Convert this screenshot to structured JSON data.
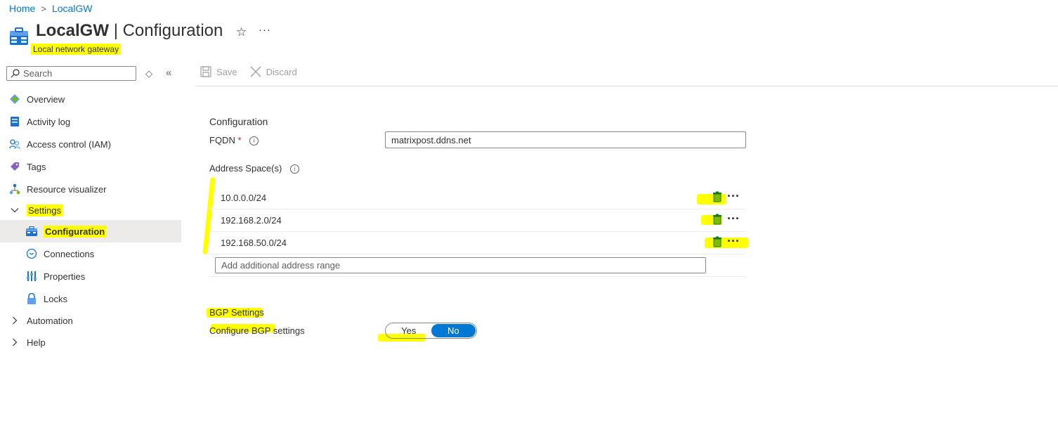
{
  "breadcrumb": {
    "home": "Home",
    "separator": ">",
    "current": "LocalGW"
  },
  "header": {
    "resource_name": "LocalGW",
    "divider": "|",
    "page_name": "Configuration",
    "subtitle": "Local network gateway",
    "favorite_icon": "star-icon",
    "more_icon": "ellipsis-icon"
  },
  "sidebar": {
    "search_placeholder": "Search",
    "items": [
      {
        "label": "Overview",
        "icon": "overview-icon"
      },
      {
        "label": "Activity log",
        "icon": "activity-log-icon"
      },
      {
        "label": "Access control (IAM)",
        "icon": "iam-icon"
      },
      {
        "label": "Tags",
        "icon": "tag-icon"
      },
      {
        "label": "Resource visualizer",
        "icon": "visualizer-icon"
      },
      {
        "label": "Settings",
        "icon": "chevron-down-icon",
        "expanded": true
      },
      {
        "label": "Configuration",
        "icon": "gateway-icon",
        "selected": true
      },
      {
        "label": "Connections",
        "icon": "connections-icon"
      },
      {
        "label": "Properties",
        "icon": "properties-icon"
      },
      {
        "label": "Locks",
        "icon": "lock-icon"
      },
      {
        "label": "Automation",
        "icon": "chevron-right-icon"
      },
      {
        "label": "Help",
        "icon": "chevron-right-icon"
      }
    ]
  },
  "toolbar": {
    "save": "Save",
    "discard": "Discard"
  },
  "form": {
    "section_title": "Configuration",
    "fqdn_label": "FQDN",
    "required_mark": "*",
    "fqdn_value": "matrixpost.ddns.net",
    "address_space_label": "Address Space(s)",
    "address_spaces": [
      "10.0.0.0/24",
      "192.168.2.0/24",
      "192.168.50.0/24"
    ],
    "add_placeholder": "Add additional address range"
  },
  "bgp": {
    "section_title": "BGP Settings",
    "configure_label": "Configure BGP settings",
    "yes": "Yes",
    "no": "No",
    "selected": "No"
  },
  "colors": {
    "accent": "#0078d4",
    "highlight": "#ffff00",
    "selected_bg": "#edebe9"
  }
}
